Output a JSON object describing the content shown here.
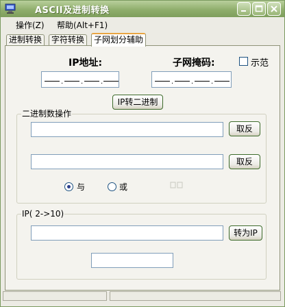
{
  "window": {
    "title": "ASCII及进制转换"
  },
  "menu": [
    {
      "label": "操作(Z)"
    },
    {
      "label": "帮助(Alt+F1)"
    }
  ],
  "tabs": [
    {
      "label": "进制转换"
    },
    {
      "label": "字符转换"
    },
    {
      "label": "子网划分辅助"
    }
  ],
  "subnet": {
    "ip_label": "IP地址:",
    "mask_label": "子网掩码:",
    "demo_label": "示范",
    "convert_button": "IP转二进制"
  },
  "binary_group": {
    "title": "二进制数操作",
    "invert1": "取反",
    "invert2": "取反",
    "and_label": "与",
    "or_label": "或",
    "and_selected": true
  },
  "ip_group": {
    "title": "IP( 2->10)",
    "to_ip_button": "转为IP"
  }
}
